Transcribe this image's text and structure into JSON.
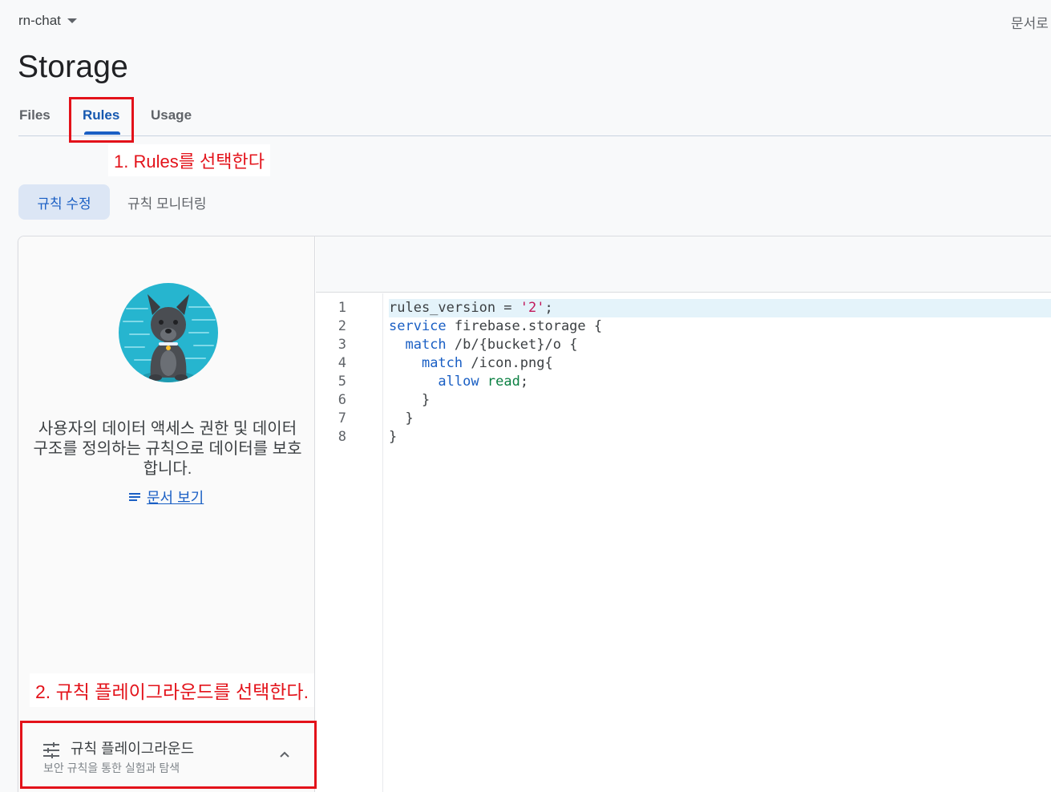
{
  "header": {
    "project_name": "rn-chat",
    "docs_link": "문서로",
    "page_title": "Storage"
  },
  "tabs": [
    {
      "label": "Files",
      "active": false
    },
    {
      "label": "Rules",
      "active": true
    },
    {
      "label": "Usage",
      "active": false
    }
  ],
  "annotations": {
    "step1": "1. Rules를 선택한다",
    "step2": "2. 규칙 플레이그라운드를 선택한다.",
    "highlight_color": "#e3121a"
  },
  "subtabs": [
    {
      "label": "규칙 수정",
      "active": true
    },
    {
      "label": "규칙 모니터링",
      "active": false
    }
  ],
  "left_panel": {
    "mascot_icon": "dog-mascot-illustration",
    "description": "사용자의 데이터 액세스 권한 및 데이터 구조를 정의하는 규칙으로 데이터를 보호합니다.",
    "doc_link_label": "문서 보기",
    "doc_link_icon": "notes-icon"
  },
  "playground": {
    "title": "규칙 플레이그라운드",
    "subtitle": "보안 규칙을 통한 실험과 탐색",
    "icon": "tune-icon",
    "expand_icon": "chevron-up-icon"
  },
  "editor": {
    "line_numbers": [
      "1",
      "2",
      "3",
      "4",
      "5",
      "6",
      "7",
      "8"
    ],
    "highlighted_line": 1,
    "lines": [
      "rules_version = '2';",
      "service firebase.storage {",
      "  match /b/{bucket}/o {",
      "    match /icon.png{",
      "      allow read;",
      "    }",
      "  }",
      "}"
    ]
  },
  "colors": {
    "accent": "#1a5fc4",
    "active_chip_bg": "#dce6f5",
    "current_line_bg": "#e4f3fa"
  }
}
